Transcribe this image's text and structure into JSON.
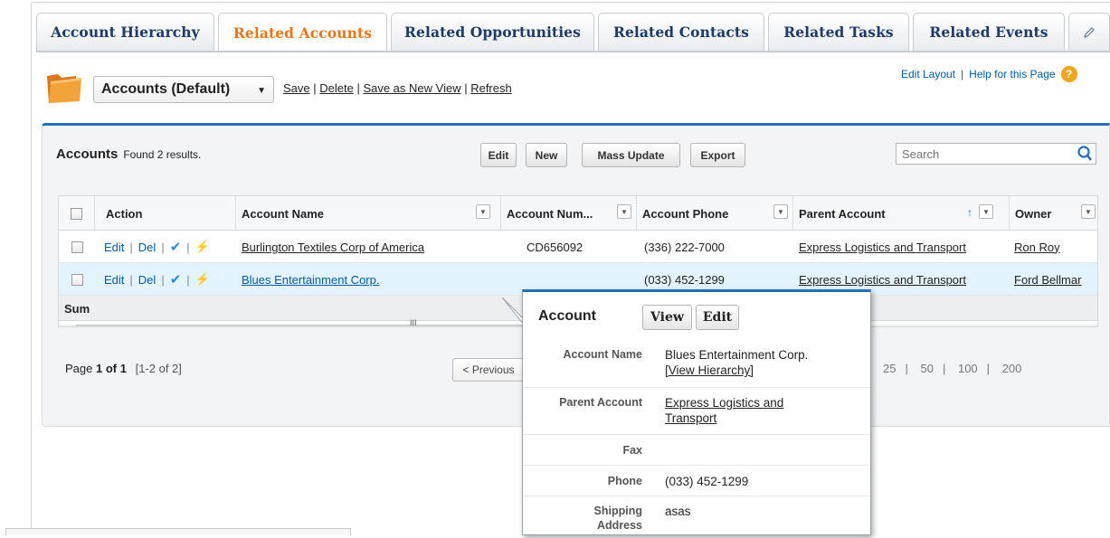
{
  "tabs": [
    {
      "label": "Account Hierarchy"
    },
    {
      "label": "Related Accounts"
    },
    {
      "label": "Related Opportunities"
    },
    {
      "label": "Related Contacts"
    },
    {
      "label": "Related Tasks"
    },
    {
      "label": "Related Events"
    }
  ],
  "active_tab": "Related Accounts",
  "view": {
    "selected": "Accounts (Default)",
    "links": [
      "Save",
      "Delete",
      "Save as New View",
      "Refresh"
    ]
  },
  "top_links": {
    "edit_layout": "Edit Layout",
    "separator": "|",
    "help": "Help for this Page",
    "help_icon_glyph": "?"
  },
  "panel": {
    "title": "Accounts",
    "result_text": "Found 2 results.",
    "buttons": {
      "edit": "Edit",
      "new": "New",
      "mass_update": "Mass Update",
      "export": "Export"
    },
    "search_placeholder": "Search"
  },
  "grid": {
    "columns": [
      "Action",
      "Account Name",
      "Account Num...",
      "Account Phone",
      "Parent Account",
      "Owner"
    ],
    "rows": [
      {
        "edit": "Edit",
        "del": "Del",
        "account_name": "Burlington Textiles Corp of America",
        "account_number": "CD656092",
        "phone": "(336) 222-7000",
        "parent": "Express Logistics and Transport",
        "owner": "Ron Roy"
      },
      {
        "edit": "Edit",
        "del": "Del",
        "account_name": "Blues Entertainment Corp.",
        "account_number": "",
        "phone": "(033) 452-1299",
        "parent": "Express Logistics and Transport",
        "owner": "Ford Bellmar"
      }
    ],
    "sum_label": "Sum",
    "scroll_mid_glyph": "III"
  },
  "pagination": {
    "page_prefix": "Page ",
    "page_value": "1 of 1",
    "range": "[1-2 of 2]",
    "previous": "< Previous",
    "sizes": [
      "25",
      "50",
      "100",
      "200"
    ]
  },
  "popup": {
    "title": "Account",
    "buttons": {
      "view": "View",
      "edit": "Edit"
    },
    "fields": [
      {
        "label": "Account Name",
        "value": "Blues Entertainment Corp.",
        "link": "[View Hierarchy]"
      },
      {
        "label": "Parent Account",
        "value": "Express Logistics and Transport"
      },
      {
        "label": "Fax",
        "value": ""
      },
      {
        "label": "Phone",
        "value": "(033) 452-1299"
      },
      {
        "label": "Shipping Address",
        "value": "asas"
      }
    ]
  },
  "colors": {
    "accent_blue": "#236fbd",
    "active_tab": "#e8761d",
    "link": "#015ba7",
    "row_highlight": "#e3f3ff",
    "help_icon": "#f0a51f"
  }
}
